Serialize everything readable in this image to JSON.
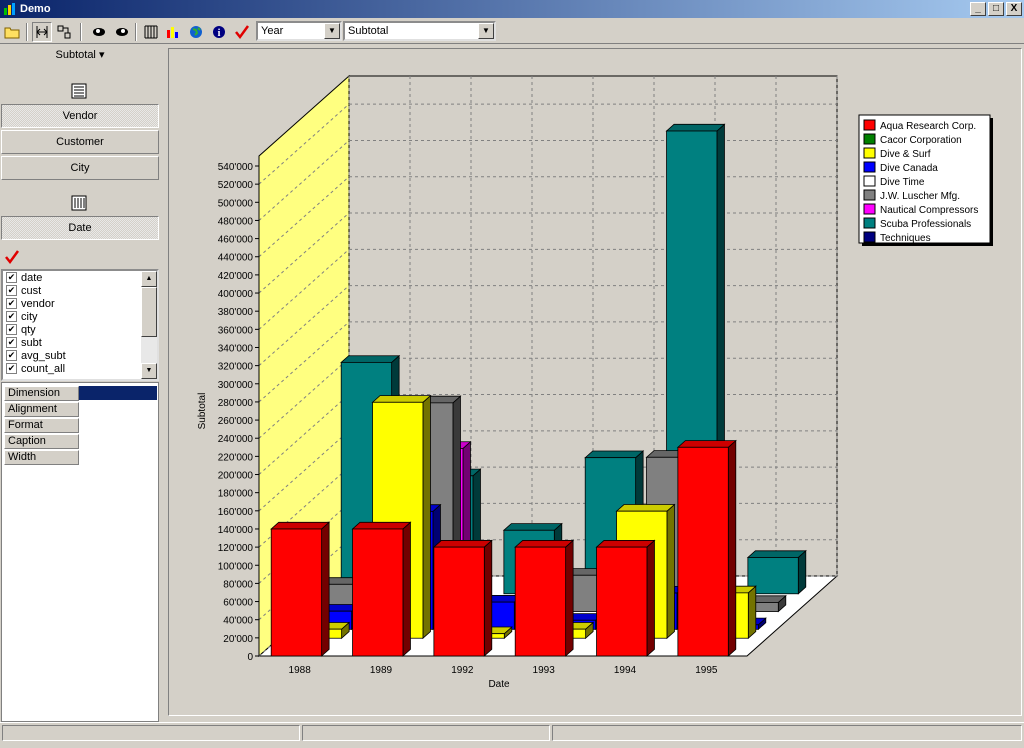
{
  "window": {
    "title": "Demo",
    "min": "_",
    "max": "□",
    "close": "X"
  },
  "toolbar": {
    "icons": [
      "open-folder-icon",
      "swap-axes-icon",
      "layout-icon",
      "zoom-in-icon",
      "zoom-out-icon",
      "columns-icon",
      "bar-chart-icon",
      "globe-icon",
      "info-icon",
      "checkmark-icon"
    ],
    "year_select": "Year",
    "measure_select": "Subtotal"
  },
  "left": {
    "measure_dropdown": "Subtotal",
    "row_buttons": [
      "Vendor",
      "Customer",
      "City"
    ],
    "col_buttons": [
      "Date"
    ],
    "fields": [
      "date",
      "cust",
      "vendor",
      "city",
      "qty",
      "subt",
      "avg_subt",
      "count_all"
    ],
    "props": [
      "Dimension",
      "Alignment",
      "Format",
      "Caption",
      "Width"
    ]
  },
  "chart_data": {
    "type": "bar",
    "xlabel": "Date",
    "ylabel": "Subtotal",
    "ylim": [
      0,
      540000
    ],
    "ytick_step": 20000,
    "categories": [
      "1988",
      "1989",
      "1992",
      "1993",
      "1994",
      "1995"
    ],
    "legend_position": "top-right",
    "series": [
      {
        "name": "Aqua Research Corp.",
        "color": "#ff0000",
        "values": [
          140000,
          140000,
          120000,
          120000,
          120000,
          230000
        ]
      },
      {
        "name": "Cacor Corporation",
        "color": "#008000",
        "values": [
          0,
          0,
          0,
          0,
          0,
          0
        ]
      },
      {
        "name": "Dive & Surf",
        "color": "#ffff00",
        "values": [
          10000,
          260000,
          5000,
          10000,
          140000,
          50000
        ]
      },
      {
        "name": "Dive Canada",
        "color": "#0000ff",
        "values": [
          20000,
          130000,
          30000,
          10000,
          40000,
          5000
        ]
      },
      {
        "name": "Dive Time",
        "color": "#ffffff",
        "values": [
          0,
          0,
          0,
          0,
          0,
          0
        ]
      },
      {
        "name": "J.W.  Luscher Mfg.",
        "color": "#808080",
        "values": [
          30000,
          230000,
          10000,
          40000,
          170000,
          10000
        ]
      },
      {
        "name": "Nautical Compressors",
        "color": "#ff00ff",
        "values": [
          0,
          170000,
          0,
          0,
          0,
          0
        ]
      },
      {
        "name": "Scuba Professionals",
        "color": "#008080",
        "values": [
          255000,
          130000,
          70000,
          150000,
          510000,
          40000
        ]
      },
      {
        "name": "Techniques",
        "color": "#000080",
        "values": [
          0,
          0,
          0,
          5000,
          30000,
          0
        ]
      }
    ]
  }
}
